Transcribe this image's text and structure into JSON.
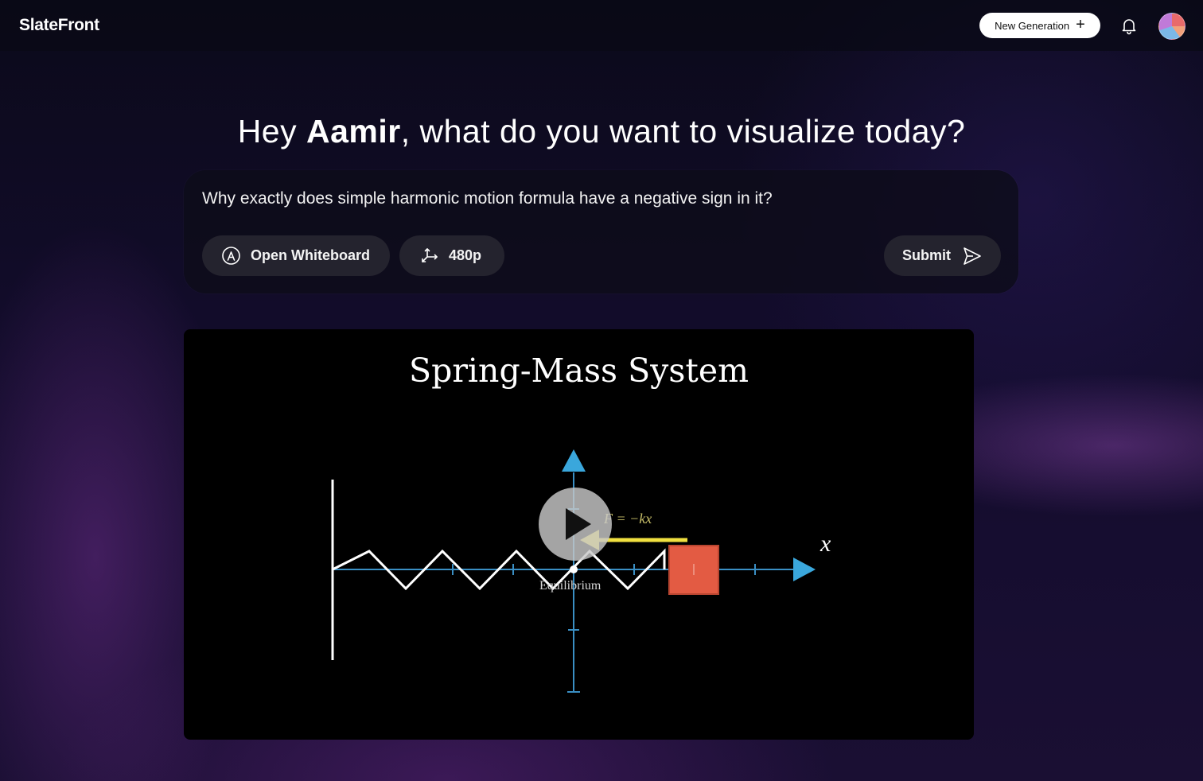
{
  "app": {
    "brand": "SlateFront",
    "new_generation_label": "New Generation",
    "icons": [
      "plus-icon",
      "bell-icon",
      "avatar"
    ]
  },
  "greeting": {
    "prefix": "Hey ",
    "name": "Aamir",
    "suffix": ", what do you want to visualize today?"
  },
  "prompt": {
    "value": "Why exactly does simple harmonic motion formula have a negative sign in it?",
    "whiteboard_label": "Open Whiteboard",
    "resolution_label": "480p",
    "submit_label": "Submit"
  },
  "video": {
    "scene_title": "Spring-Mass System",
    "equilibrium_label": "Equilibrium",
    "axis_label": "x",
    "force_label": "F = −kx",
    "colors": {
      "axis": "#3a8fc4",
      "arrow": "#3aa7dc",
      "force": "#f0e040",
      "mass": "#e35b43",
      "spring": "#ffffff"
    }
  }
}
